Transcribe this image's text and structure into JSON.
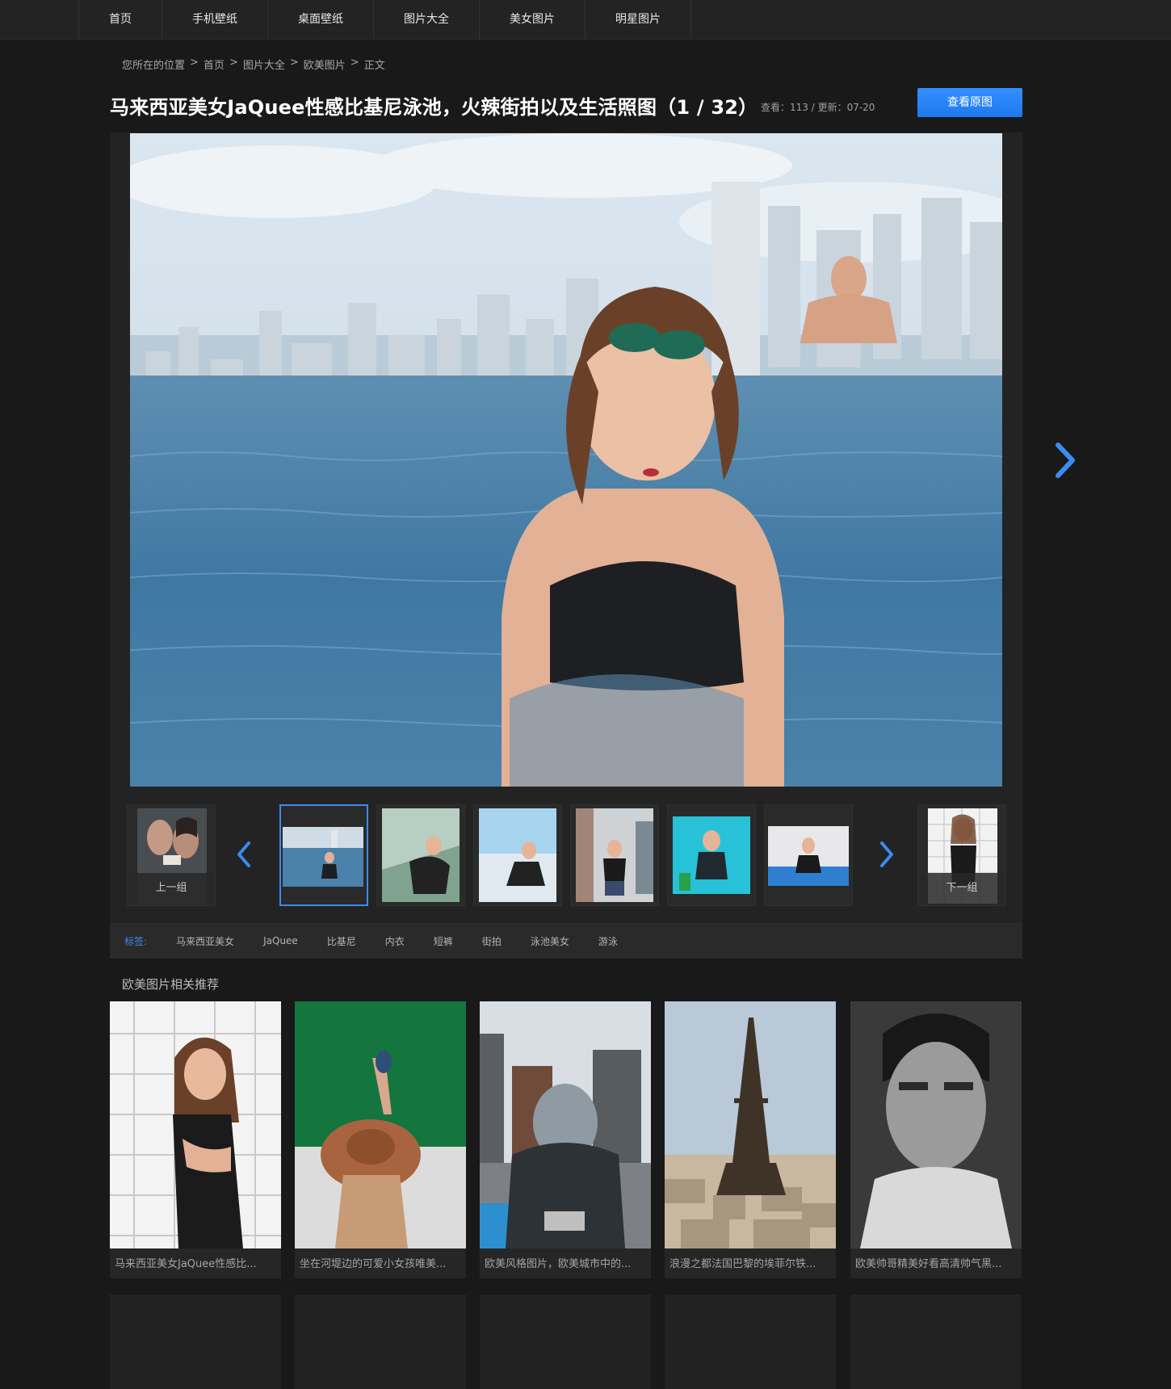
{
  "nav": {
    "items": [
      "首页",
      "手机壁纸",
      "桌面壁纸",
      "图片大全",
      "美女图片",
      "明星图片"
    ]
  },
  "breadcrumb": {
    "prefix": "您所在的位置",
    "items": [
      "首页",
      "图片大全",
      "欧美图片",
      "正文"
    ],
    "separator": ">"
  },
  "header": {
    "title": "马来西亚美女JaQuee性感比基尼泳池，火辣街拍以及生活照图（1 / 32）",
    "meta": "查看：113 / 更新：07-20",
    "view_original": "查看原图"
  },
  "strip": {
    "prev_group": "上一组",
    "next_group": "下一组",
    "active_index": 0,
    "thumb_count": 6
  },
  "tags": {
    "label": "标签:",
    "items": [
      "马来西亚美女",
      "JaQuee",
      "比基尼",
      "内衣",
      "短裤",
      "街拍",
      "泳池美女",
      "游泳"
    ]
  },
  "related": {
    "title": "欧美图片相关推荐",
    "items": [
      {
        "caption": "马来西亚美女JaQuee性感比..."
      },
      {
        "caption": "坐在河堤边的可爱小女孩唯美..."
      },
      {
        "caption": "欧美风格图片，欧美城市中的..."
      },
      {
        "caption": "浪漫之都法国巴黎的埃菲尔铁..."
      },
      {
        "caption": "欧美帅哥精美好看高清帅气黑..."
      }
    ]
  },
  "colors": {
    "accent": "#3b8bf0",
    "background": "#191919",
    "panel": "#232323"
  }
}
